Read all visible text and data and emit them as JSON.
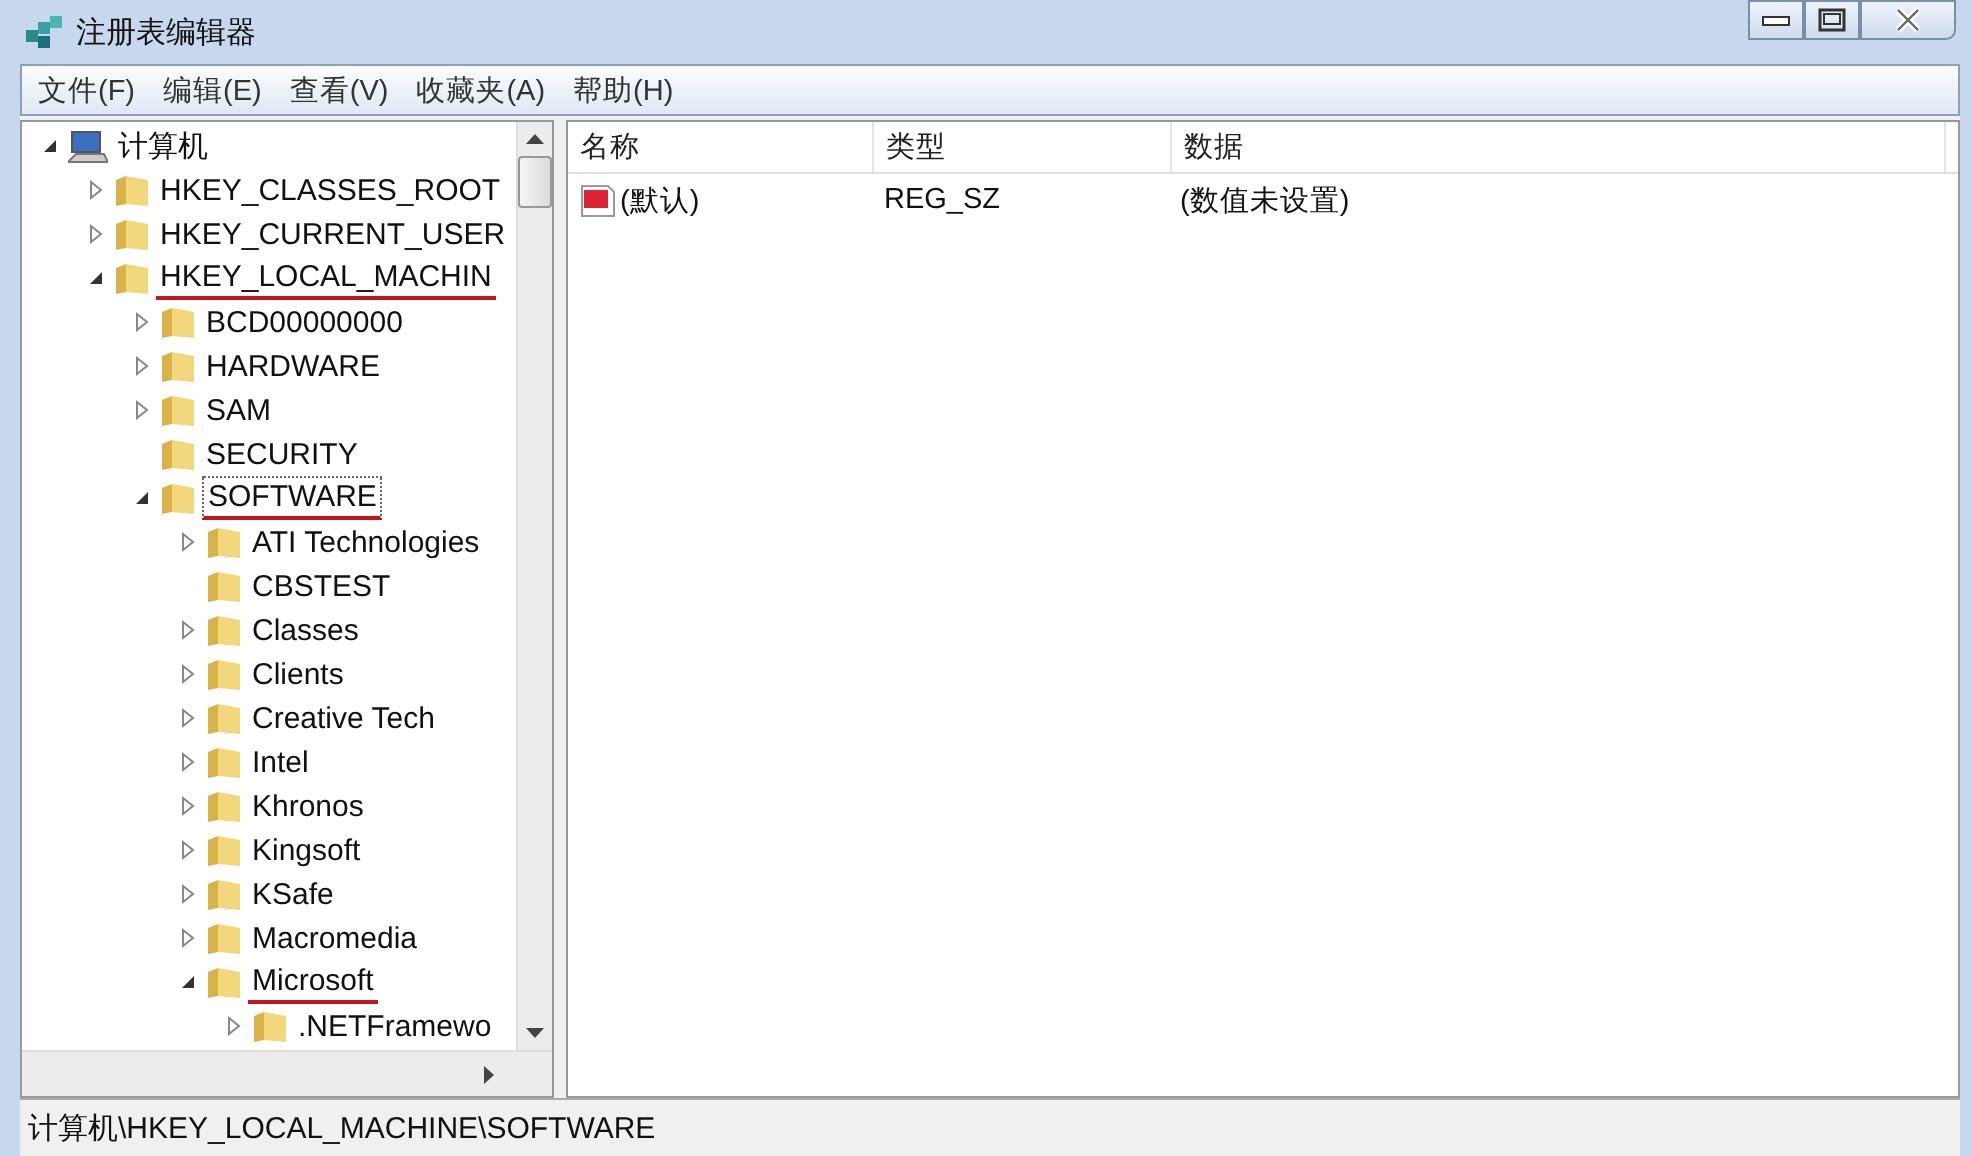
{
  "window": {
    "title": "注册表编辑器"
  },
  "menu": [
    "文件(F)",
    "编辑(E)",
    "查看(V)",
    "收藏夹(A)",
    "帮助(H)"
  ],
  "tree": [
    {
      "label": "计算机",
      "kind": "expanded",
      "marked": false,
      "children": [
        {
          "label": "HKEY_CLASSES_ROOT",
          "kind": "collapsed",
          "marked": false
        },
        {
          "label": "HKEY_CURRENT_USER",
          "kind": "collapsed",
          "marked": false
        },
        {
          "label": "HKEY_LOCAL_MACHIN",
          "kind": "expanded",
          "marked": true,
          "children": [
            {
              "label": "BCD00000000",
              "kind": "collapsed",
              "marked": false
            },
            {
              "label": "HARDWARE",
              "kind": "collapsed",
              "marked": false
            },
            {
              "label": "SAM",
              "kind": "collapsed",
              "marked": false
            },
            {
              "label": "SECURITY",
              "kind": "leaf",
              "marked": false
            },
            {
              "label": "SOFTWARE",
              "kind": "expanded",
              "marked": true,
              "selected": true,
              "children": [
                {
                  "label": "ATI Technologies",
                  "kind": "collapsed",
                  "marked": false
                },
                {
                  "label": "CBSTEST",
                  "kind": "leaf",
                  "marked": false
                },
                {
                  "label": "Classes",
                  "kind": "collapsed",
                  "marked": false
                },
                {
                  "label": "Clients",
                  "kind": "collapsed",
                  "marked": false
                },
                {
                  "label": "Creative Tech",
                  "kind": "collapsed",
                  "marked": false
                },
                {
                  "label": "Intel",
                  "kind": "collapsed",
                  "marked": false
                },
                {
                  "label": "Khronos",
                  "kind": "collapsed",
                  "marked": false
                },
                {
                  "label": "Kingsoft",
                  "kind": "collapsed",
                  "marked": false
                },
                {
                  "label": "KSafe",
                  "kind": "collapsed",
                  "marked": false
                },
                {
                  "label": "Macromedia",
                  "kind": "collapsed",
                  "marked": false
                },
                {
                  "label": "Microsoft",
                  "kind": "expanded",
                  "marked": true,
                  "children": [
                    {
                      "label": ".NETFramewo",
                      "kind": "collapsed",
                      "marked": false
                    }
                  ]
                }
              ]
            }
          ]
        }
      ]
    }
  ],
  "table": {
    "columns": [
      "名称",
      "类型",
      "数据"
    ],
    "rows": [
      {
        "cells": [
          "(默认)",
          "REG_SZ",
          "(数值未设置)"
        ]
      }
    ]
  },
  "status_bar": "计算机\\HKEY_LOCAL_MACHINE\\SOFTWARE"
}
